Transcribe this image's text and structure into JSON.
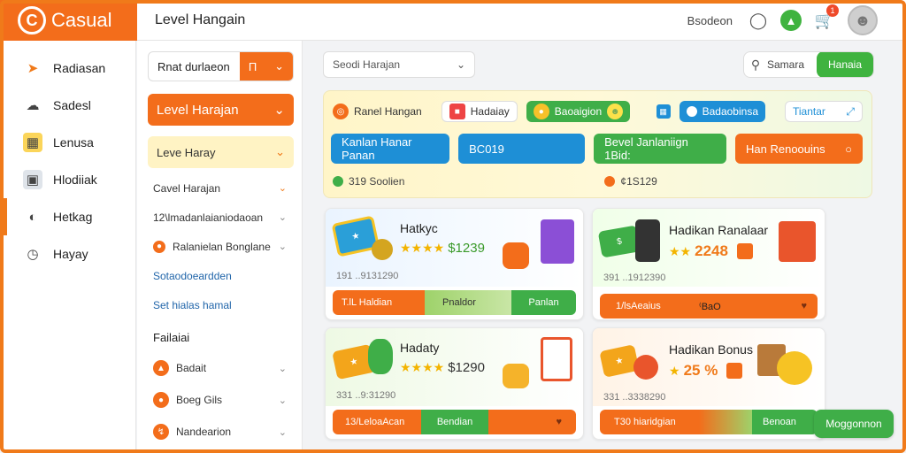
{
  "brand": {
    "name": "Casual",
    "logo_glyph": "C"
  },
  "header": {
    "title": "Level Hangain",
    "user": "Bsodeon",
    "cart_count": "1"
  },
  "sidebar": {
    "items": [
      {
        "label": "Radiasan",
        "icon": "rocket-icon"
      },
      {
        "label": "Sadesl",
        "icon": "cloud-icon"
      },
      {
        "label": "Lenusa",
        "icon": "chart-icon"
      },
      {
        "label": "Hlodiiak",
        "icon": "book-icon"
      },
      {
        "label": "Hetkag",
        "icon": "globe-icon"
      },
      {
        "label": "Hayay",
        "icon": "clock-icon"
      }
    ]
  },
  "subnav": {
    "filter_text": "Rnat durlaeon",
    "filter_btn": "Π",
    "level_btn": "Level Harajan",
    "level_select": "Leve Haray",
    "items": [
      {
        "label": "Cavel Harajan",
        "style": "normal"
      },
      {
        "label": "12\\lmadanlaianiodaoan",
        "style": "normal"
      },
      {
        "label": "Ralanielan Bonglane",
        "style": "icon"
      },
      {
        "label": "Sotaodoeardden",
        "style": "link"
      },
      {
        "label": "Set hialas hamal",
        "style": "link"
      },
      {
        "label": "Failaiai",
        "style": "header"
      },
      {
        "label": "Badait",
        "style": "dot"
      },
      {
        "label": "Boeg Gils",
        "style": "dot"
      },
      {
        "label": "Nandearion",
        "style": "dot"
      }
    ]
  },
  "main": {
    "search_placeholder": "Seodi Harajan",
    "search_right_label": "Samara",
    "search_right_btn": "Hanaia",
    "panel": {
      "title": "Ranel Hangan",
      "chip1": "Hadaiay",
      "chip2": "Baoaigion",
      "chip3": "Badaobinsa",
      "chip4": "Tiantar",
      "btn1": "Kanlan Hanar Panan",
      "btn2": "BC019",
      "btn3": "Bevel Janlaniign 1Bid:",
      "btn4": "Han Renoouins",
      "foot1": "319 Soolien",
      "foot2": "¢1S129"
    },
    "cards": [
      {
        "title": "Hatkyc",
        "price": "$1239",
        "sub": "191 ..9131290",
        "bar1": "T.lL Haldian",
        "bar2": "Pnaldor",
        "bar3": "Panlan"
      },
      {
        "title": "Hadikan Ranalaar",
        "price": "2248",
        "sub": "391 ..1912390",
        "bar1": "1/lsAeaius",
        "bar2": "⁽BaO",
        "bar3": ""
      },
      {
        "title": "Hadaty",
        "price": "$1290",
        "sub": "331 ..9:31290",
        "bar1": "13/LeloaAcan",
        "bar2": "Bendian",
        "bar3": ""
      },
      {
        "title": "Hadikan Bonus",
        "price": "25 %",
        "sub": "331 ..3338290",
        "bar1": "T30 hiaridgian",
        "bar2": "",
        "bar3": "Benoan"
      }
    ],
    "float_btn": "Moggonnon"
  }
}
